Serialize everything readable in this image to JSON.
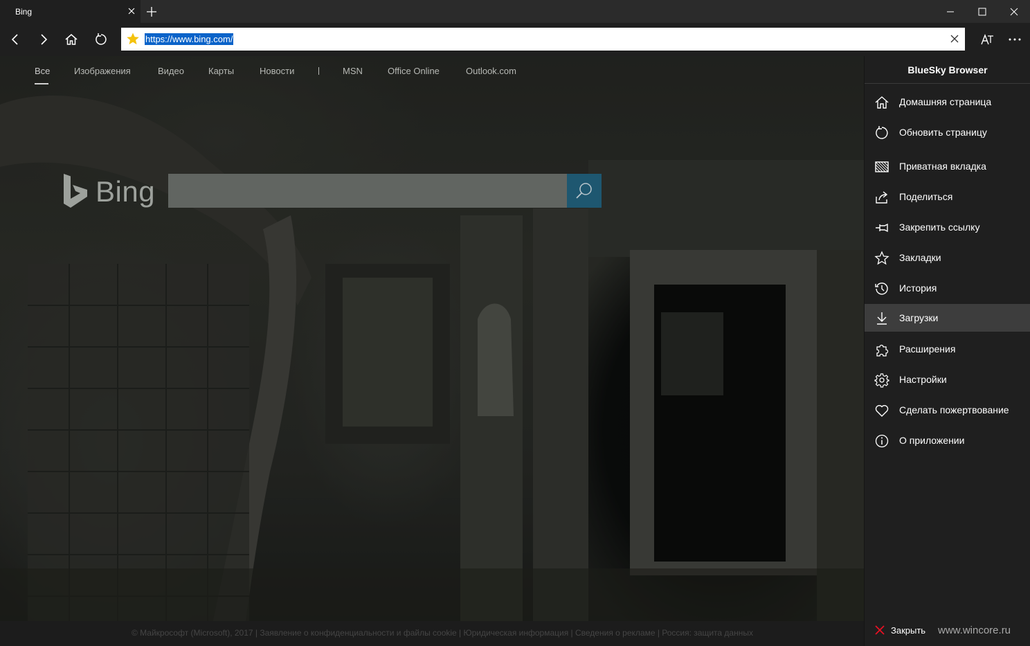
{
  "tab": {
    "title": "Bing"
  },
  "address": {
    "url": "https://www.bing.com/"
  },
  "bing_nav": [
    "Все",
    "Изображения",
    "Видео",
    "Карты",
    "Новости",
    "MSN",
    "Office Online",
    "Outlook.com"
  ],
  "bing": {
    "logo_text": "Bing"
  },
  "footer": {
    "text": "© Майкрософт (Microsoft), 2017   |   Заявление о конфиденциальности и файлы cookie   |   Юридическая информация   |   Сведения о рекламе   |   Россия: защита данных"
  },
  "menu": {
    "title": "BlueSky Browser",
    "items": [
      {
        "label": "Домашняя страница",
        "icon": "home-icon"
      },
      {
        "label": "Обновить страницу",
        "icon": "refresh-icon"
      },
      {
        "label": "Приватная вкладка",
        "icon": "private-tab-icon"
      },
      {
        "label": "Поделиться",
        "icon": "share-icon"
      },
      {
        "label": "Закрепить ссылку",
        "icon": "pin-icon"
      },
      {
        "label": "Закладки",
        "icon": "star-icon"
      },
      {
        "label": "История",
        "icon": "history-icon"
      },
      {
        "label": "Загрузки",
        "icon": "download-icon",
        "active": true
      },
      {
        "label": "Расширения",
        "icon": "extension-icon"
      },
      {
        "label": "Настройки",
        "icon": "gear-icon"
      },
      {
        "label": "Сделать пожертвование",
        "icon": "heart-icon"
      },
      {
        "label": "О приложении",
        "icon": "info-icon"
      }
    ],
    "close_label": "Закрыть"
  },
  "watermark": "www.wincore.ru",
  "colors": {
    "accent_url": "#0a63c9",
    "favorite_star": "#f4c20d",
    "close_red": "#e81123",
    "search_btn": "#1e5770"
  }
}
